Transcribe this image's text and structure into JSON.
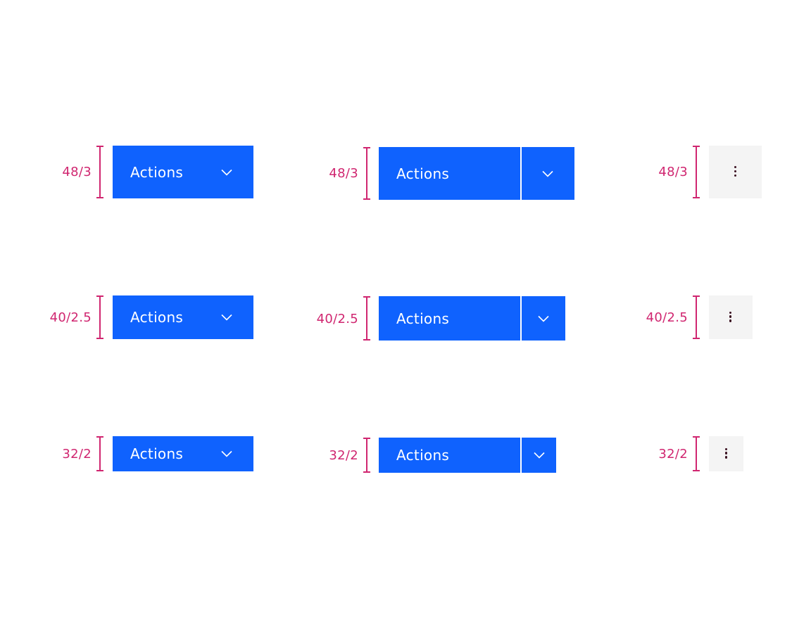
{
  "colors": {
    "primary": "#0f62fe",
    "annotation": "#d02670",
    "overflow_bg": "#f4f4f4",
    "icon_dark": "#161616"
  },
  "rows": [
    {
      "size": "48/3",
      "menu_button": {
        "label": "Actions",
        "icon": "chevron-down-icon"
      },
      "split_button": {
        "label": "Actions",
        "icon": "chevron-down-icon"
      },
      "overflow_button": {
        "icon": "overflow-menu-vertical-icon"
      },
      "labels": [
        "48/3",
        "48/3",
        "48/3"
      ]
    },
    {
      "size": "40/2.5",
      "menu_button": {
        "label": "Actions",
        "icon": "chevron-down-icon"
      },
      "split_button": {
        "label": "Actions",
        "icon": "chevron-down-icon"
      },
      "overflow_button": {
        "icon": "overflow-menu-vertical-icon"
      },
      "labels": [
        "40/2.5",
        "40/2.5",
        "40/2.5"
      ]
    },
    {
      "size": "32/2",
      "menu_button": {
        "label": "Actions",
        "icon": "chevron-down-icon"
      },
      "split_button": {
        "label": "Actions",
        "icon": "chevron-down-icon"
      },
      "overflow_button": {
        "icon": "overflow-menu-vertical-icon"
      },
      "labels": [
        "32/2",
        "32/2",
        "32/2"
      ]
    }
  ]
}
